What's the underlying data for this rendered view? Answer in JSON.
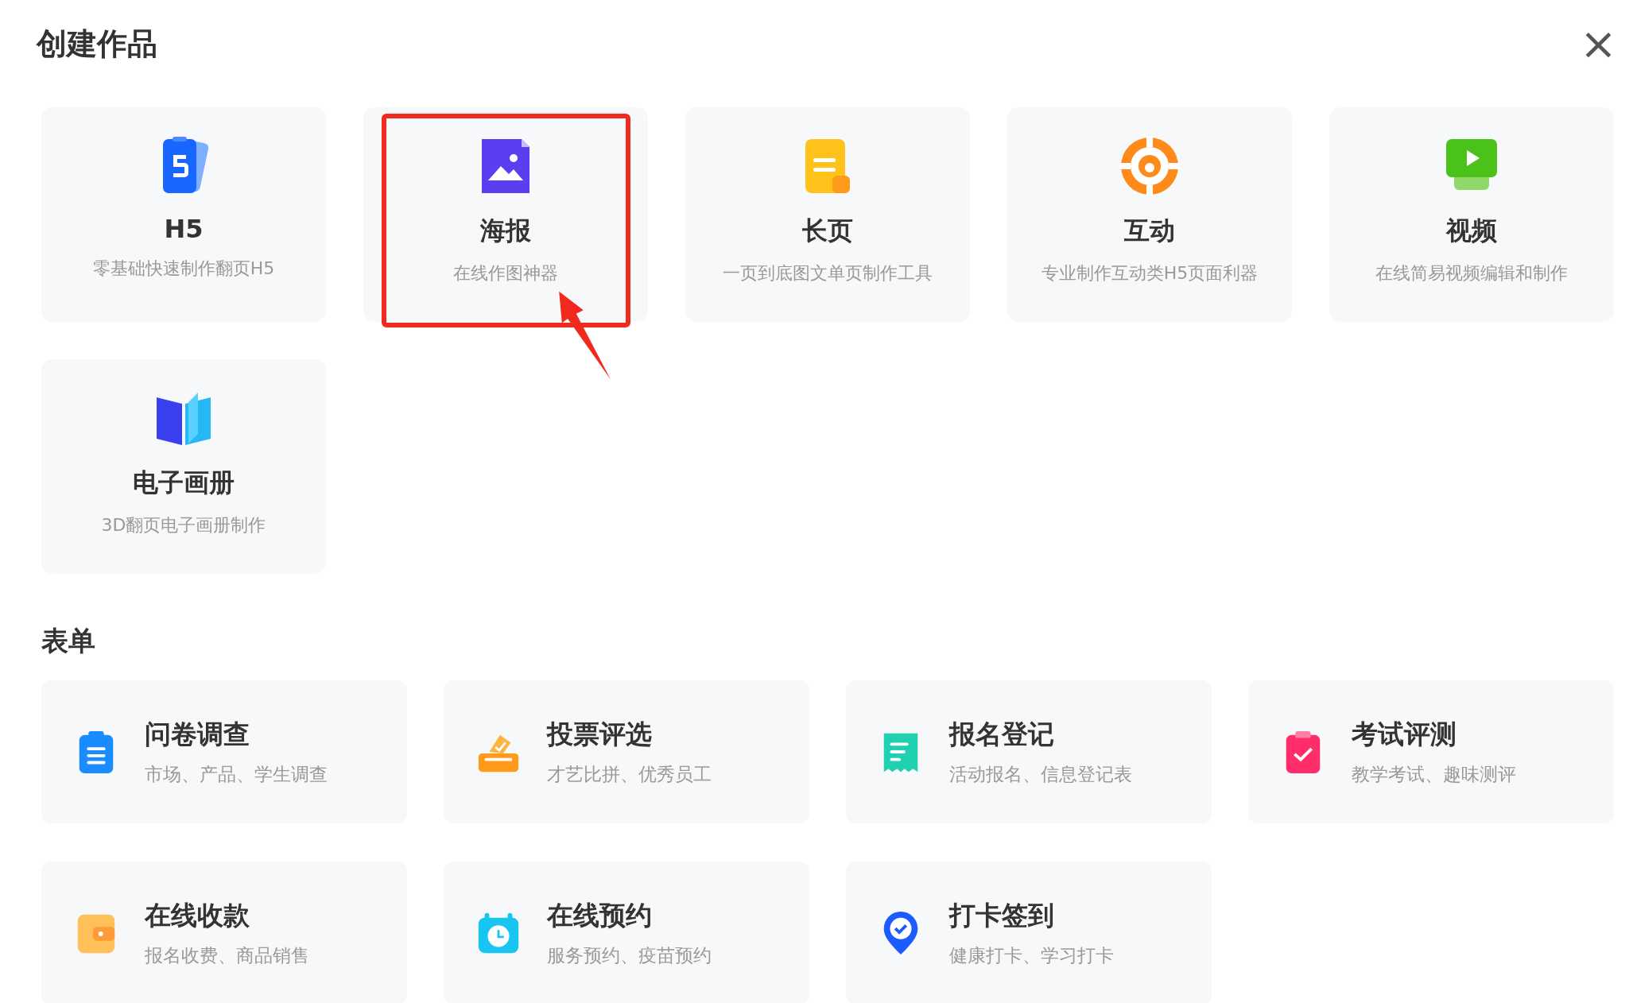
{
  "dialog": {
    "title": "创建作品",
    "close": "×"
  },
  "works": [
    {
      "kind": "h5",
      "title": "H5",
      "subtitle": "零基础快速制作翻页H5",
      "highlighted": false
    },
    {
      "kind": "poster",
      "title": "海报",
      "subtitle": "在线作图神器",
      "highlighted": true
    },
    {
      "kind": "longpage",
      "title": "长页",
      "subtitle": "一页到底图文单页制作工具",
      "highlighted": false
    },
    {
      "kind": "interactive",
      "title": "互动",
      "subtitle": "专业制作互动类H5页面利器",
      "highlighted": false
    },
    {
      "kind": "video",
      "title": "视频",
      "subtitle": "在线简易视频编辑和制作",
      "highlighted": false
    },
    {
      "kind": "album",
      "title": "电子画册",
      "subtitle": "3D翻页电子画册制作",
      "highlighted": false
    }
  ],
  "forms_section": {
    "title": "表单"
  },
  "forms": [
    {
      "kind": "survey",
      "title": "问卷调查",
      "subtitle": "市场、产品、学生调查"
    },
    {
      "kind": "vote",
      "title": "投票评选",
      "subtitle": "才艺比拼、优秀员工"
    },
    {
      "kind": "signup",
      "title": "报名登记",
      "subtitle": "活动报名、信息登记表"
    },
    {
      "kind": "exam",
      "title": "考试评测",
      "subtitle": "教学考试、趣味测评"
    },
    {
      "kind": "payment",
      "title": "在线收款",
      "subtitle": "报名收费、商品销售"
    },
    {
      "kind": "booking",
      "title": "在线预约",
      "subtitle": "服务预约、疫苗预约"
    },
    {
      "kind": "checkin",
      "title": "打卡签到",
      "subtitle": "健康打卡、学习打卡"
    }
  ]
}
